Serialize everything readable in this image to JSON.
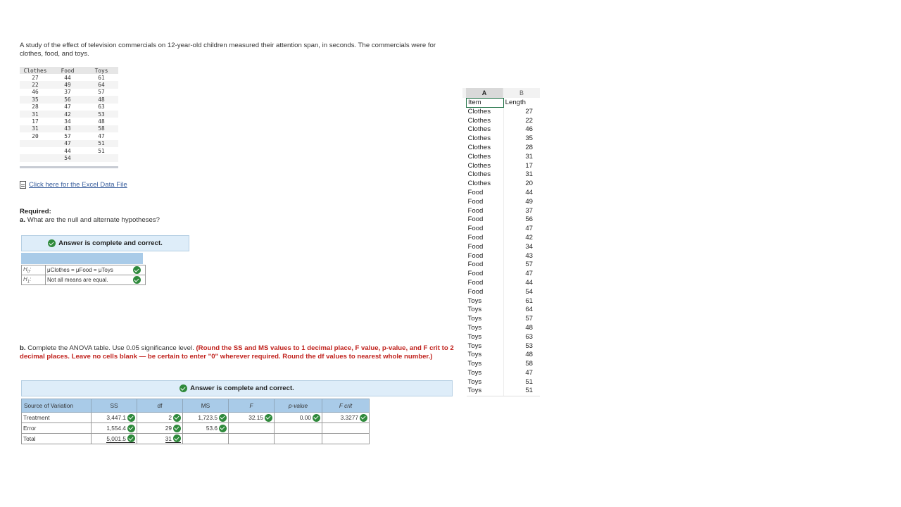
{
  "intro": "A study of the effect of television commercials on 12-year-old children measured their attention span, in seconds. The commercials were for clothes, food, and toys.",
  "data_table": {
    "headers": [
      "Clothes",
      "Food",
      "Toys"
    ],
    "rows": [
      [
        "27",
        "44",
        "61"
      ],
      [
        "22",
        "49",
        "64"
      ],
      [
        "46",
        "37",
        "57"
      ],
      [
        "35",
        "56",
        "48"
      ],
      [
        "28",
        "47",
        "63"
      ],
      [
        "31",
        "42",
        "53"
      ],
      [
        "17",
        "34",
        "48"
      ],
      [
        "31",
        "43",
        "58"
      ],
      [
        "20",
        "57",
        "47"
      ],
      [
        "",
        "47",
        "51"
      ],
      [
        "",
        "44",
        "51"
      ],
      [
        "",
        "54",
        ""
      ]
    ]
  },
  "excel_link": "Click here for the Excel Data File",
  "required": "Required:",
  "question_a": {
    "letter": "a.",
    "text": "What are the null and alternate hypotheses?"
  },
  "answer_banner": "Answer is complete and correct.",
  "hypotheses": [
    {
      "label_main": "H",
      "label_sub": "0",
      "value": "μClothes = μFood = μToys"
    },
    {
      "label_main": "H",
      "label_sub": "1",
      "value": "Not all means are equal."
    }
  ],
  "question_b": {
    "letter": "b.",
    "text": "Complete the ANOVA table. Use 0.05 significance level.",
    "instruction": "(Round the SS and MS values to 1 decimal place, F value, p-value, and F crit to 2 decimal places. Leave no cells blank — be certain to enter \"0\" wherever required. Round the df values to nearest whole number.)"
  },
  "anova": {
    "headers": [
      "Source of Variation",
      "SS",
      "df",
      "MS",
      "F",
      "p-value",
      "F crit"
    ],
    "rows": [
      {
        "source": "Treatment",
        "ss": "3,447.1",
        "df": "2",
        "ms": "1,723.5",
        "f": "32.15",
        "p": "0.00",
        "fcrit": "3.3277"
      },
      {
        "source": "Error",
        "ss": "1,554.4",
        "df": "29",
        "ms": "53.6",
        "f": "",
        "p": "",
        "fcrit": ""
      },
      {
        "source": "Total",
        "ss": "5,001.5",
        "df": "31",
        "ms": "",
        "f": "",
        "p": "",
        "fcrit": ""
      }
    ]
  },
  "excel": {
    "col_a": "A",
    "col_b": "B",
    "header": {
      "item": "Item",
      "length": "Length"
    },
    "rows": [
      [
        "Clothes",
        "27"
      ],
      [
        "Clothes",
        "22"
      ],
      [
        "Clothes",
        "46"
      ],
      [
        "Clothes",
        "35"
      ],
      [
        "Clothes",
        "28"
      ],
      [
        "Clothes",
        "31"
      ],
      [
        "Clothes",
        "17"
      ],
      [
        "Clothes",
        "31"
      ],
      [
        "Clothes",
        "20"
      ],
      [
        "Food",
        "44"
      ],
      [
        "Food",
        "49"
      ],
      [
        "Food",
        "37"
      ],
      [
        "Food",
        "56"
      ],
      [
        "Food",
        "47"
      ],
      [
        "Food",
        "42"
      ],
      [
        "Food",
        "34"
      ],
      [
        "Food",
        "43"
      ],
      [
        "Food",
        "57"
      ],
      [
        "Food",
        "47"
      ],
      [
        "Food",
        "44"
      ],
      [
        "Food",
        "54"
      ],
      [
        "Toys",
        "61"
      ],
      [
        "Toys",
        "64"
      ],
      [
        "Toys",
        "57"
      ],
      [
        "Toys",
        "48"
      ],
      [
        "Toys",
        "63"
      ],
      [
        "Toys",
        "53"
      ],
      [
        "Toys",
        "48"
      ],
      [
        "Toys",
        "58"
      ],
      [
        "Toys",
        "47"
      ],
      [
        "Toys",
        "51"
      ],
      [
        "Toys",
        "51"
      ]
    ]
  },
  "colors": {
    "check": "#2f8a3c",
    "banner": "#deedf9",
    "header_blue": "#a9cbe8",
    "instruction_red": "#c0221d",
    "link": "#3a5f9d"
  }
}
